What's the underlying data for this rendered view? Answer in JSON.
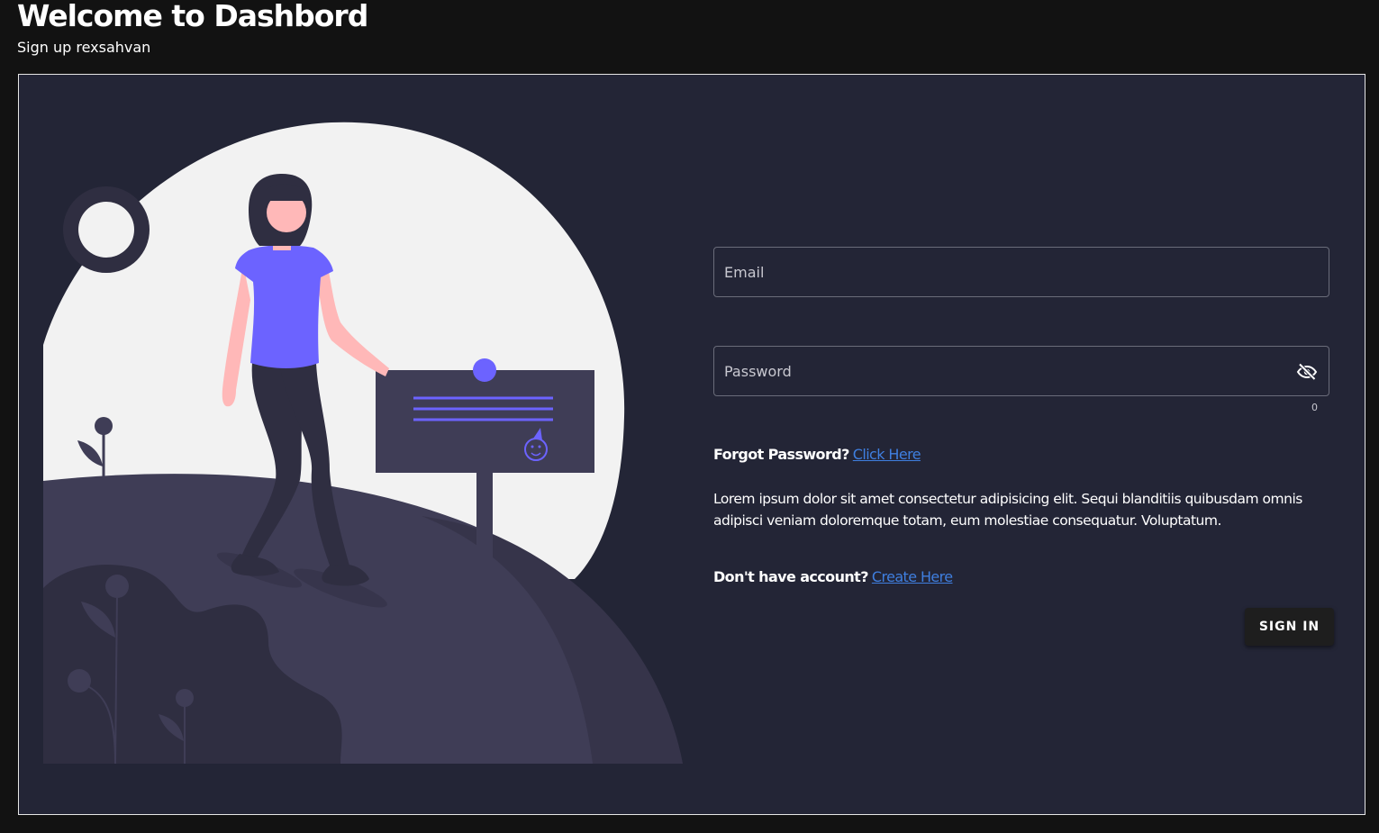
{
  "header": {
    "title": "Welcome to Dashbord",
    "subtitle": "Sign up rexsahvan"
  },
  "form": {
    "email": {
      "placeholder": "Email",
      "value": ""
    },
    "password": {
      "placeholder": "Password",
      "value": "",
      "char_count": "0",
      "toggle_icon": "eye-off-icon"
    },
    "forgot": {
      "prompt": "Forgot Password?",
      "link": "Click Here"
    },
    "description": "Lorem ipsum dolor sit amet consectetur adipisicing elit. Sequi blanditiis quibusdam omnis adipisci veniam doloremque totam, eum molestiae consequatur. Voluptatum.",
    "signup": {
      "prompt": "Don't have account?",
      "link": "Create Here"
    },
    "submit_label": "SIGN IN"
  },
  "colors": {
    "page_bg": "#121212",
    "card_bg": "#232536",
    "accent": "#6c63ff",
    "link": "#3f7fe0",
    "moon": "#f2f2f2",
    "hill_dark": "#2f2e41",
    "hill_light": "#3f3d56",
    "skin": "#ffb8b8"
  }
}
